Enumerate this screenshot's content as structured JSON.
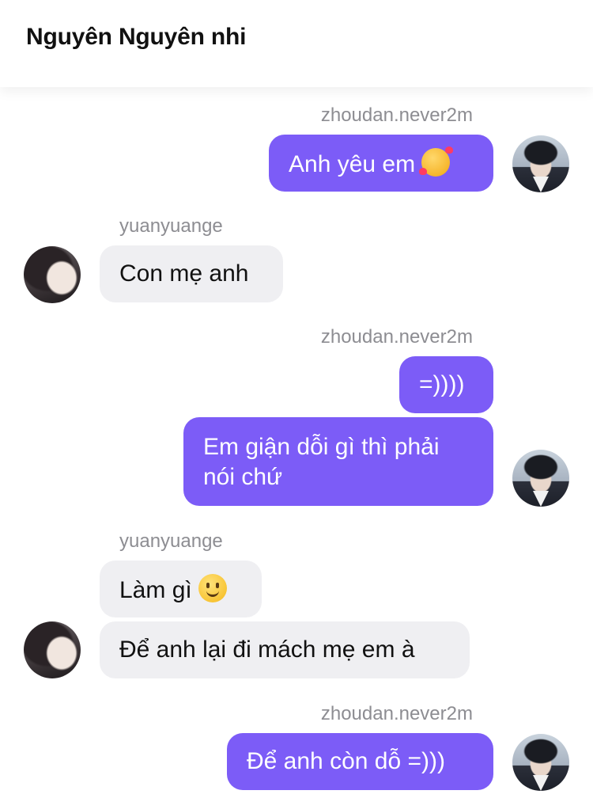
{
  "header": {
    "title": "Nguyên Nguyên nhi"
  },
  "messages": [
    {
      "sender": "zhoudan.never2m",
      "text": "Anh yêu em",
      "emoji": "smiling-face-with-hearts-icon"
    },
    {
      "sender": "yuanyuange",
      "text": "Con mẹ anh"
    },
    {
      "sender": "zhoudan.never2m",
      "text": "=))))"
    },
    {
      "text": "Em giận dỗi gì thì phải nói chứ"
    },
    {
      "sender": "yuanyuange",
      "text": "Làm gì",
      "emoji": "slightly-smiling-face-icon"
    },
    {
      "text": "Để anh lại đi mách mẹ em à"
    },
    {
      "sender": "zhoudan.never2m",
      "text": "Để anh còn dỗ =)))"
    }
  ],
  "colors": {
    "outgoing_bubble": "#7c5cf7",
    "incoming_bubble": "#efeff2",
    "sender_name": "#8d8d92"
  }
}
